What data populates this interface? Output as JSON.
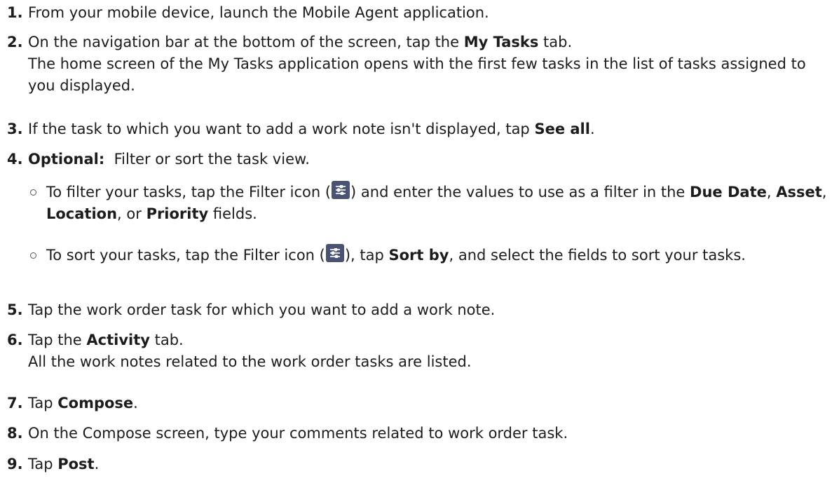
{
  "steps": [
    {
      "num": "1.",
      "text": "From your mobile device, launch the Mobile Agent application."
    },
    {
      "num": "2.",
      "pre": "On the navigation bar at the bottom of the screen, tap the ",
      "bold": "My Tasks",
      "post": " tab.",
      "result": "The home screen of the My Tasks application opens with the first few tasks in the list of tasks assigned to you displayed."
    },
    {
      "num": "3.",
      "pre": "If the task to which you want to add a work note isn't displayed, tap ",
      "bold": "See all",
      "post": "."
    },
    {
      "num": "4.",
      "bold": "Optional:",
      "post": "  Filter or sort the task view.",
      "subs": [
        {
          "pre": "To filter your tasks, tap the Filter icon (",
          "mid": ") and enter the values to use as a filter in the ",
          "b1": "Due Date",
          "s1": ", ",
          "b2": "Asset",
          "s2": ", ",
          "b3": "Location",
          "s3": ", or ",
          "b4": "Priority",
          "post": " fields."
        },
        {
          "pre": "To sort your tasks, tap the Filter icon (",
          "mid": "), tap ",
          "b1": "Sort by",
          "post": ", and select the fields to sort your tasks."
        }
      ]
    },
    {
      "num": "5.",
      "text": "Tap the work order task for which you want to add a work note."
    },
    {
      "num": "6.",
      "pre": "Tap the ",
      "bold": "Activity",
      "post": " tab.",
      "result": "All the work notes related to the work order tasks are listed."
    },
    {
      "num": "7.",
      "pre": "Tap ",
      "bold": "Compose",
      "post": "."
    },
    {
      "num": "8.",
      "text": "On the Compose screen, type your comments related to work order task."
    },
    {
      "num": "9.",
      "pre": "Tap ",
      "bold": "Post",
      "post": "."
    }
  ],
  "icons": {
    "filter": "filter-icon",
    "filter_color": "#4b5372"
  }
}
